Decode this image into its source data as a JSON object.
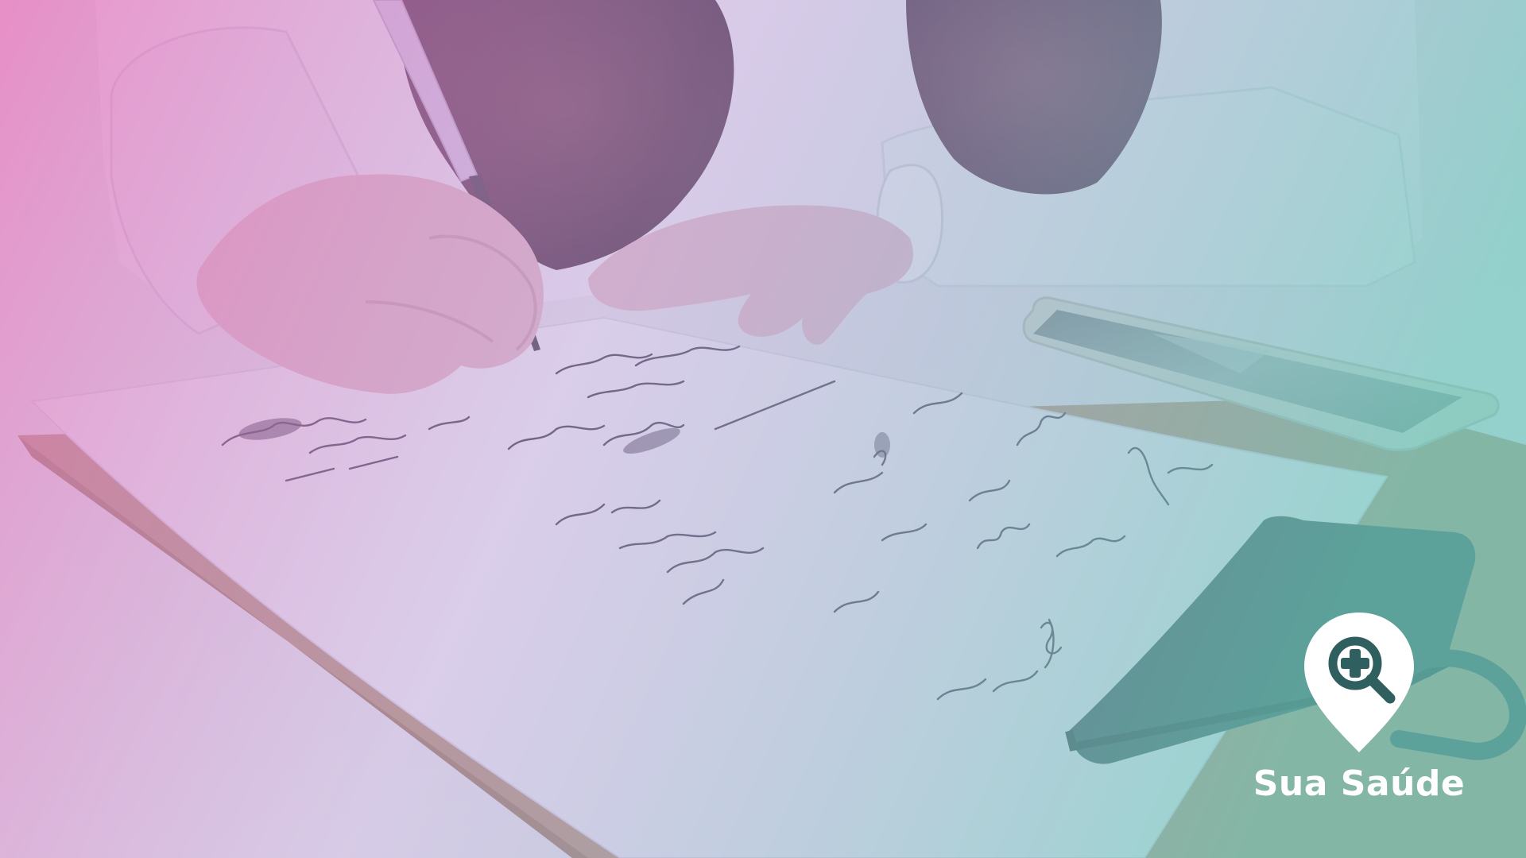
{
  "scene": {
    "subject": "person-writing-on-clipboard",
    "colors": {
      "overlay_left": "#e86fb8",
      "overlay_mid": "#b9a2d8",
      "overlay_right": "#6fc7bd",
      "table": "#eceaf0",
      "paper": "#f4f0f8",
      "clipboard": "#b68f70",
      "clip": "#2f4b4a",
      "hair": "#5a3048",
      "coat": "#f0e8f4",
      "skin": "#e6b5c2",
      "phone_body": "#d8d8cf",
      "phone_screen": "#8c9996",
      "ink": "#3e3246"
    }
  },
  "brand": {
    "name": "Sua Saúde",
    "icon": "location-pin-search-plus-icon",
    "color": "#ffffff",
    "accent": "#2f5f5e"
  }
}
